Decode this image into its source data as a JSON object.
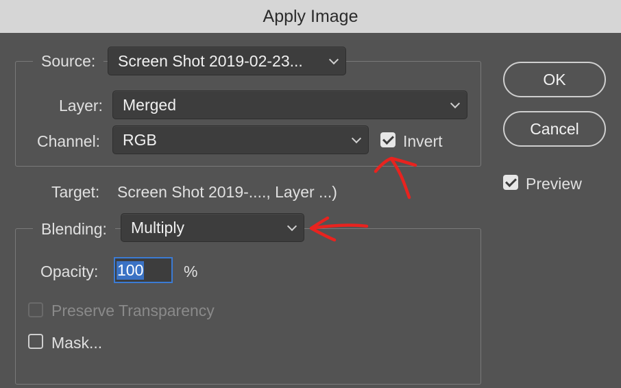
{
  "window": {
    "title": "Apply Image"
  },
  "source": {
    "label": "Source:",
    "value": "Screen Shot 2019-02-23..."
  },
  "layer": {
    "label": "Layer:",
    "value": "Merged"
  },
  "channel": {
    "label": "Channel:",
    "value": "RGB"
  },
  "invert": {
    "label": "Invert",
    "checked": true
  },
  "target": {
    "label": "Target:",
    "value": "Screen Shot 2019-...., Layer ...)"
  },
  "blending": {
    "label": "Blending:",
    "value": "Multiply"
  },
  "opacity": {
    "label": "Opacity:",
    "value": "100",
    "unit": "%"
  },
  "preserve_transparency": {
    "label": "Preserve Transparency",
    "checked": false,
    "enabled": false
  },
  "mask": {
    "label": "Mask...",
    "checked": false
  },
  "buttons": {
    "ok": "OK",
    "cancel": "Cancel"
  },
  "preview": {
    "label": "Preview",
    "checked": true
  },
  "colors": {
    "annotation": "#e8231f",
    "selection": "#3a72c4",
    "background": "#535353"
  }
}
